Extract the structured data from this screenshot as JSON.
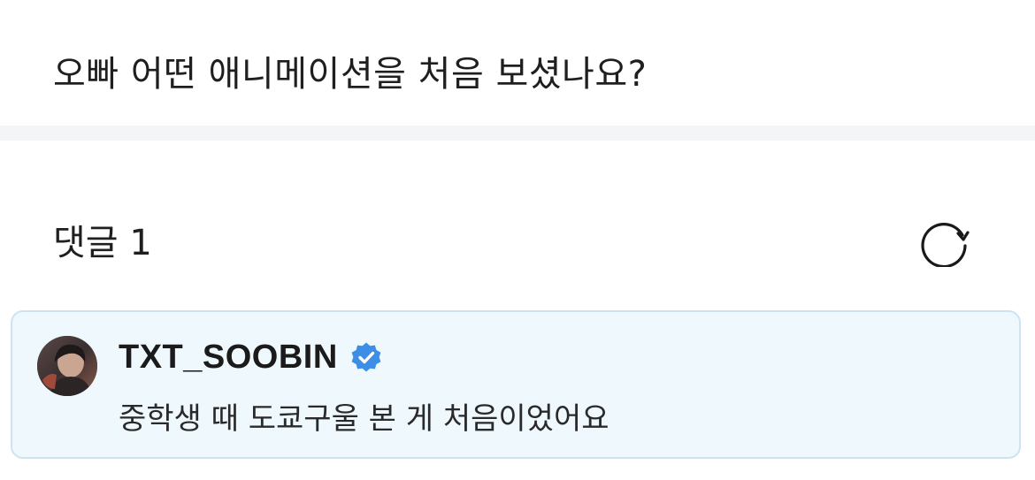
{
  "post": {
    "question": "오빠 어떤 애니메이션을 처음 보셨나요?"
  },
  "comments": {
    "title": "댓글 1",
    "refresh_icon": "refresh-icon"
  },
  "comment": {
    "author": "TXT_SOOBIN",
    "verified_icon": "verified-badge-icon",
    "text": "중학생 때 도쿄구울 본 게 처음이었어요"
  },
  "colors": {
    "card_background": "#eef8fd",
    "card_border": "#cfe3ef",
    "verified_blue": "#3d8ee6",
    "divider": "#f4f5f7"
  }
}
